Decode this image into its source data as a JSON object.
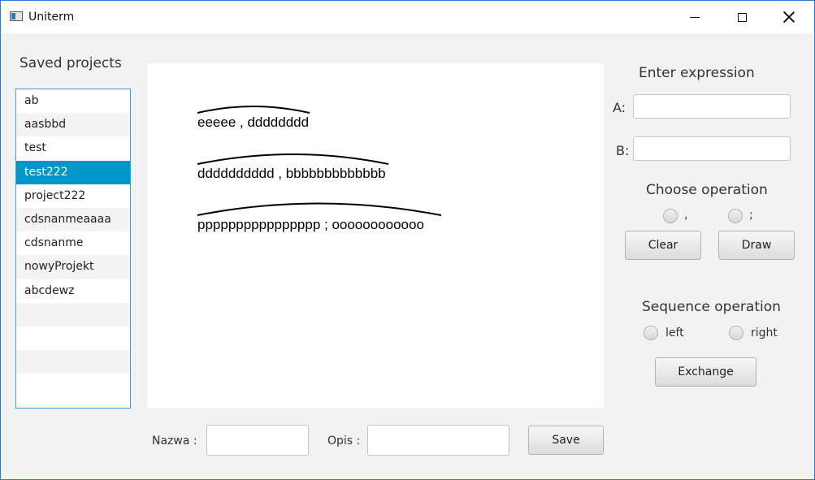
{
  "window": {
    "title": "Uniterm"
  },
  "left": {
    "saved_projects_label": "Saved projects",
    "projects": [
      "ab",
      "aasbbd",
      "test",
      "test222",
      "project222",
      "cdsnanmeaaaa",
      "cdsnanme",
      "nowyProjekt",
      "abcdewz"
    ],
    "selected": "test222"
  },
  "canvas": {
    "expressions": [
      "eeeee , dddddddd",
      "dddddddddd , bbbbbbbbbbbbb",
      "pppppppppppppppp ; oooooooooooo"
    ]
  },
  "right": {
    "enter_expression": "Enter expression",
    "a_label": "A:",
    "b_label": "B:",
    "a_value": "",
    "b_value": "",
    "choose_operation": "Choose operation",
    "op_comma": ",",
    "op_semicolon": ";",
    "clear_label": "Clear",
    "draw_label": "Draw",
    "sequence_operation": "Sequence operation",
    "left_label": "left",
    "right_label": "right",
    "exchange_label": "Exchange"
  },
  "bottom": {
    "nazwa_label": "Nazwa :",
    "opis_label": "Opis :",
    "nazwa_value": "",
    "opis_value": "",
    "save_label": "Save"
  }
}
